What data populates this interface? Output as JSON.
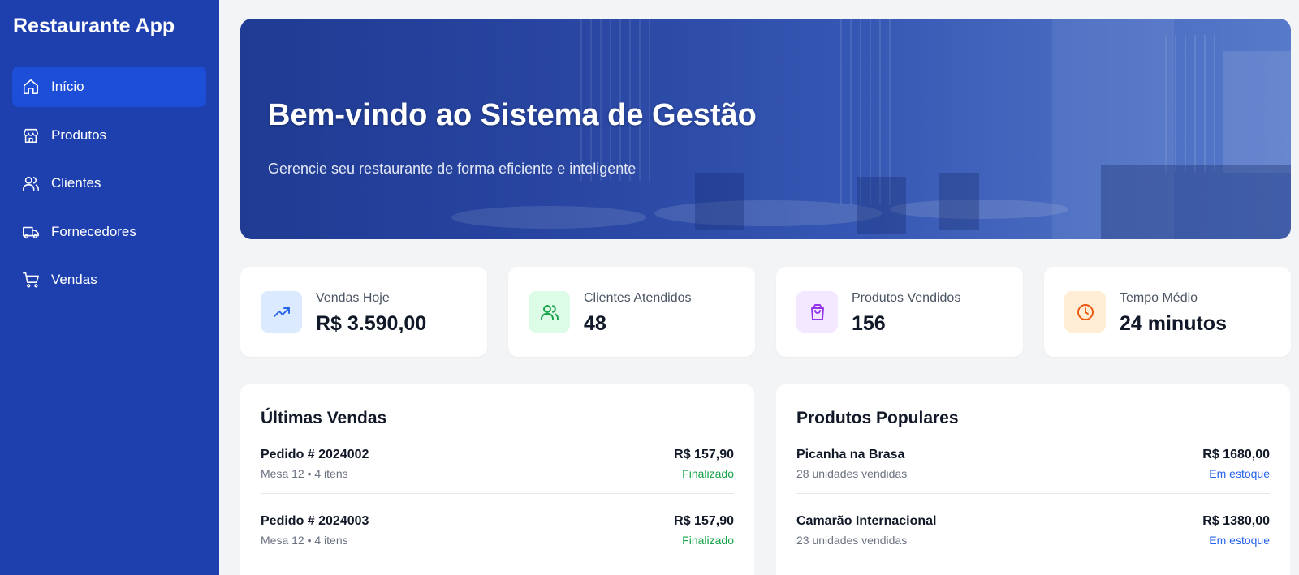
{
  "app": {
    "title": "Restaurante App"
  },
  "sidebar": {
    "items": [
      {
        "label": "Início",
        "icon": "home-icon",
        "active": true
      },
      {
        "label": "Produtos",
        "icon": "store-icon",
        "active": false
      },
      {
        "label": "Clientes",
        "icon": "users-icon",
        "active": false
      },
      {
        "label": "Fornecedores",
        "icon": "truck-icon",
        "active": false
      },
      {
        "label": "Vendas",
        "icon": "cart-icon",
        "active": false
      }
    ]
  },
  "hero": {
    "title": "Bem-vindo ao Sistema de Gestão",
    "subtitle": "Gerencie seu restaurante de forma eficiente e inteligente"
  },
  "stats": [
    {
      "label": "Vendas Hoje",
      "value": "R$ 3.590,00",
      "icon": "trending-up-icon",
      "color": "#2563eb",
      "bg": "#dbeafe"
    },
    {
      "label": "Clientes Atendidos",
      "value": "48",
      "icon": "users-icon",
      "color": "#16a34a",
      "bg": "#dcfce7"
    },
    {
      "label": "Produtos Vendidos",
      "value": "156",
      "icon": "shopping-bag-icon",
      "color": "#9333ea",
      "bg": "#f3e8ff"
    },
    {
      "label": "Tempo Médio",
      "value": "24 minutos",
      "icon": "clock-icon",
      "color": "#ea580c",
      "bg": "#ffedd5"
    }
  ],
  "recent_sales": {
    "title": "Últimas Vendas",
    "items": [
      {
        "order": "Pedido # 2024002",
        "detail": "Mesa 12 • 4 itens",
        "price": "R$ 157,90",
        "status": "Finalizado",
        "status_color": "#16a34a"
      },
      {
        "order": "Pedido # 2024003",
        "detail": "Mesa 12 • 4 itens",
        "price": "R$ 157,90",
        "status": "Finalizado",
        "status_color": "#16a34a"
      }
    ]
  },
  "popular_products": {
    "title": "Produtos Populares",
    "items": [
      {
        "name": "Picanha na Brasa",
        "detail": "28 unidades vendidas",
        "price": "R$ 1680,00",
        "status": "Em estoque",
        "status_color": "#2563eb"
      },
      {
        "name": "Camarão Internacional",
        "detail": "23 unidades vendidas",
        "price": "R$ 1380,00",
        "status": "Em estoque",
        "status_color": "#2563eb"
      }
    ]
  },
  "colors": {
    "sidebar": "#1e40af",
    "active_item": "#1d4ed8",
    "background": "#f3f4f6"
  }
}
